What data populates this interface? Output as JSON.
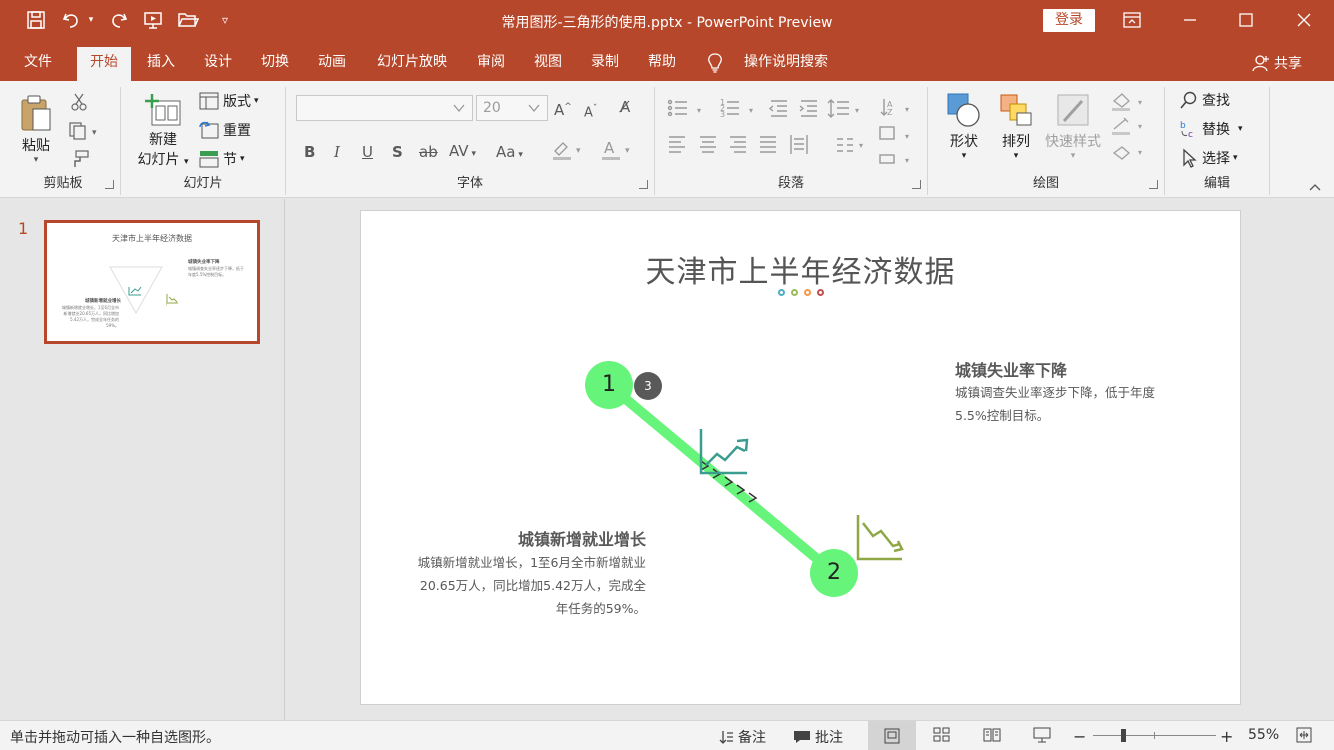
{
  "app": {
    "doc_title": "常用图形-三角形的使用.pptx  -  PowerPoint Preview",
    "login_label": "登录"
  },
  "tabs": {
    "file": "文件",
    "home": "开始",
    "insert": "插入",
    "design": "设计",
    "transitions": "切换",
    "animations": "动画",
    "slideshow": "幻灯片放映",
    "review": "审阅",
    "view": "视图",
    "record": "录制",
    "help": "帮助",
    "tell_me": "操作说明搜索",
    "share": "共享"
  },
  "ribbon": {
    "clipboard": {
      "label": "剪贴板",
      "paste": "粘贴"
    },
    "slides": {
      "label": "幻灯片",
      "new_slide_1": "新建",
      "new_slide_2": "幻灯片",
      "layout": "版式",
      "reset": "重置",
      "section": "节"
    },
    "font": {
      "label": "字体",
      "font_name": "",
      "font_size": "20"
    },
    "paragraph": {
      "label": "段落"
    },
    "drawing": {
      "label": "绘图",
      "shapes": "形状",
      "arrange": "排列",
      "quick_styles": "快速样式"
    },
    "editing": {
      "label": "编辑",
      "find": "查找",
      "replace": "替换",
      "select": "选择"
    }
  },
  "thumbnail": {
    "number": "1",
    "title": "天津市上半年经济数据",
    "right_head": "城镇失业率下降",
    "right_body": "城镇调查失业率逐步下降，低于年度5.5%控制目标。",
    "left_head": "城镇新增就业增长",
    "left_body": "城镇新增就业增长，1至6月全市新增就业20.65万人，同比增加5.42万人，完成全年任务的59%。"
  },
  "slide": {
    "title": "天津市上半年经济数据",
    "right_head": "城镇失业率下降",
    "right_body_1": "城镇调查失业率逐步下降，低于年度",
    "right_body_2": "5.5%控制目标。",
    "left_head": "城镇新增就业增长",
    "left_body_1": "城镇新增就业增长，1至6月全市新增就业",
    "left_body_2": "20.65万人，同比增加5.42万人，完成全",
    "left_body_3": "年任务的59%。",
    "point_1": "1",
    "point_2": "2",
    "badge": "3",
    "dot_colors": [
      "#4bacc6",
      "#9bbb59",
      "#f79646",
      "#c0504d"
    ],
    "path_color": "#66f57a",
    "icon_up_color": "#3a9d8f",
    "icon_down_color": "#8fa845"
  },
  "status": {
    "hint": "单击并拖动可插入一种自选图形。",
    "notes": "备注",
    "comments": "批注",
    "zoom": "55%"
  },
  "colors": {
    "accent": "#b7472a"
  }
}
